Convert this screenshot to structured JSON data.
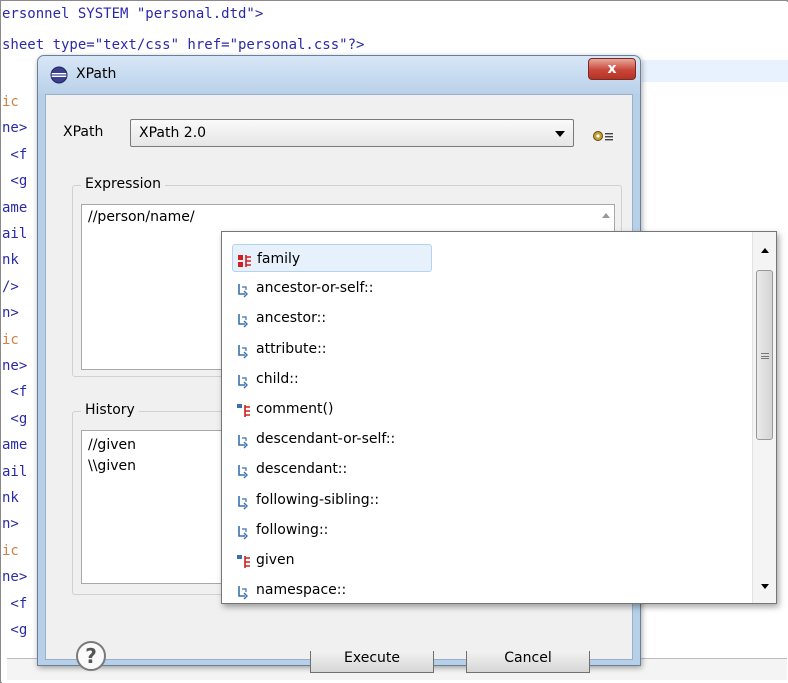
{
  "editor": {
    "lines_top": [
      "ersonnel SYSTEM \"personal.dtd\">",
      "sheet type=\"text/css\" href=\"personal.css\"?>"
    ],
    "left_fragments": [
      {
        "text": "ic",
        "color": "#d08040"
      },
      {
        "text": "ne>",
        "color": "#2a2aa8"
      },
      {
        "text": " <f",
        "color": "#2a2aa8"
      },
      {
        "text": " <g",
        "color": "#2a2aa8"
      },
      {
        "text": "ame",
        "color": "#2a2aa8"
      },
      {
        "text": "ail",
        "color": "#2a2aa8"
      },
      {
        "text": "nk ",
        "color": "#2a2aa8"
      },
      {
        "text": "/>",
        "color": "#2a2aa8"
      },
      {
        "text": "n>",
        "color": "#2a2aa8"
      },
      {
        "text": "ic",
        "color": "#d08040"
      },
      {
        "text": "ne>",
        "color": "#2a2aa8"
      },
      {
        "text": " <f",
        "color": "#2a2aa8"
      },
      {
        "text": " <g",
        "color": "#2a2aa8"
      },
      {
        "text": "ame",
        "color": "#2a2aa8"
      },
      {
        "text": "ail",
        "color": "#2a2aa8"
      },
      {
        "text": "nk ",
        "color": "#2a2aa8"
      },
      {
        "text": "n>",
        "color": "#2a2aa8"
      },
      {
        "text": "ic",
        "color": "#d08040"
      },
      {
        "text": "ne>",
        "color": "#2a2aa8"
      },
      {
        "text": " <f",
        "color": "#2a2aa8"
      },
      {
        "text": " <g",
        "color": "#2a2aa8"
      }
    ]
  },
  "dialog": {
    "title": "XPath",
    "close_label": "x",
    "xpath_label": "XPath",
    "xpath_version": "XPath 2.0",
    "expression_title": "Expression",
    "expression_value": "//person/name/",
    "history_title": "History",
    "history_items": [
      "//given",
      "\\\\given"
    ],
    "execute_label": "Execute",
    "cancel_label": "Cancel",
    "help_label": "?"
  },
  "popup": {
    "items": [
      {
        "label": "family",
        "icon": "element-icon",
        "selected": true
      },
      {
        "label": "ancestor-or-self::",
        "icon": "axis-icon"
      },
      {
        "label": "ancestor::",
        "icon": "axis-icon"
      },
      {
        "label": "attribute::",
        "icon": "axis-icon"
      },
      {
        "label": "child::",
        "icon": "axis-icon"
      },
      {
        "label": "comment()",
        "icon": "node-icon"
      },
      {
        "label": "descendant-or-self::",
        "icon": "axis-icon"
      },
      {
        "label": "descendant::",
        "icon": "axis-icon"
      },
      {
        "label": "following-sibling::",
        "icon": "axis-icon"
      },
      {
        "label": "following::",
        "icon": "axis-icon"
      },
      {
        "label": "given",
        "icon": "node-icon"
      },
      {
        "label": "namespace::",
        "icon": "axis-icon"
      }
    ]
  },
  "colors": {
    "code_blue": "#2a2aa8",
    "code_orange": "#d08040",
    "selection_bg": "#e7f1fb",
    "axis_icon": "#3a6fb0",
    "element_icon_red": "#d02020"
  }
}
